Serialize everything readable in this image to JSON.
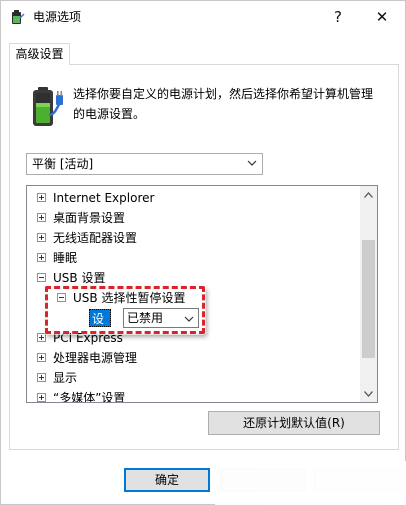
{
  "window": {
    "title": "电源选项",
    "help_glyph": "?",
    "close_glyph": "✕"
  },
  "tab": {
    "label": "高级设置"
  },
  "description": "选择你要自定义的电源计划，然后选择你希望计算机管理的电源设置。",
  "plan_select": {
    "value": "平衡 [活动]"
  },
  "tree": {
    "items": [
      {
        "label": "Internet Explorer",
        "expanded": false
      },
      {
        "label": "桌面背景设置",
        "expanded": false
      },
      {
        "label": "无线适配器设置",
        "expanded": false
      },
      {
        "label": "睡眠",
        "expanded": false
      },
      {
        "label": "USB 设置",
        "expanded": true
      },
      {
        "label": "USB 选择性暂停设置",
        "expanded": true
      },
      {
        "label": "PCI Express",
        "expanded": false
      },
      {
        "label": "处理器电源管理",
        "expanded": false
      },
      {
        "label": "显示",
        "expanded": false
      },
      {
        "label": "“多媒体”设置",
        "expanded": false
      }
    ],
    "setting_label": "设置:",
    "setting_value": "已禁用"
  },
  "buttons": {
    "restore": "还原计划默认值(R)",
    "ok": "确定"
  },
  "colors": {
    "accent": "#0078d7",
    "highlight_border": "#d9232d"
  },
  "icons": {
    "app": "power-options-icon",
    "battery": "battery-plug-icon"
  }
}
